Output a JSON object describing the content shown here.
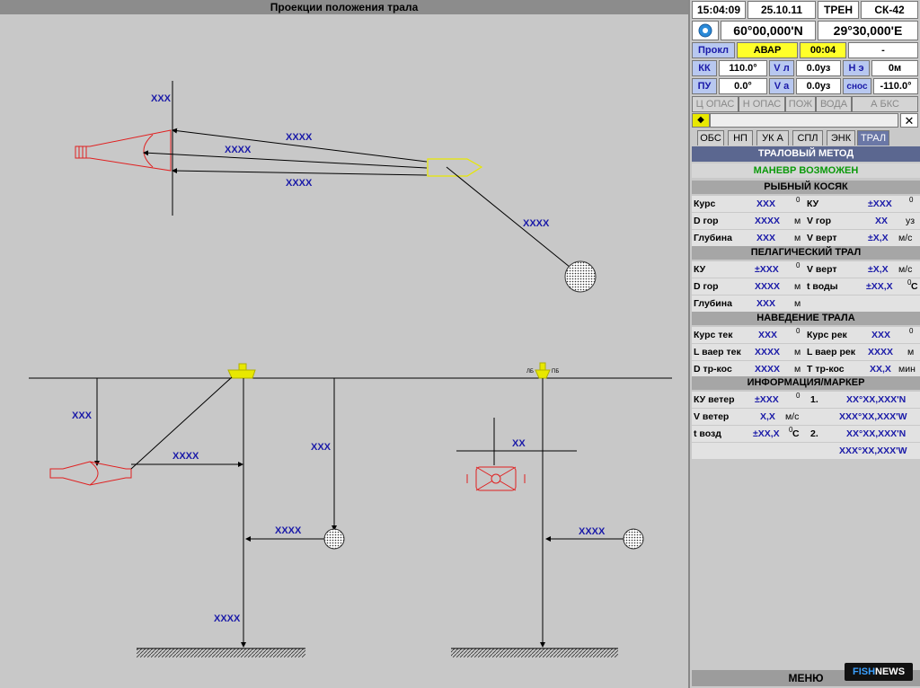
{
  "title": "Проекции положения трала",
  "header": {
    "time": "15:04:09",
    "date": "25.10.11",
    "mode": "ТРЕН",
    "system": "СК-42",
    "lat": "60°00,000'N",
    "lon": "29°30,000'E",
    "prokl_label": "Прокл",
    "avar_label": "АВАР",
    "avar_time": "00:04",
    "dash": "-",
    "kk_label": "КК",
    "kk_value": "110.0°",
    "vl_label": "V л",
    "vl_value": "0.0уз",
    "he_label": "Н э",
    "he_value": "0м",
    "pu_label": "ПУ",
    "pu_value": "0.0°",
    "va_label": "V а",
    "va_value": "0.0уз",
    "snos_label": "снос",
    "snos_value": "-110.0°"
  },
  "alarms": [
    "Ц ОПАС",
    "Н ОПАС",
    "ПОЖ",
    "ВОДА",
    "А БКС"
  ],
  "tabs": [
    "ОБС",
    "НП",
    "УК А",
    "СПЛ",
    "ЭНК",
    "ТРАЛ"
  ],
  "panel": {
    "method": "ТРАЛОВЫЙ МЕТОД",
    "maneuver": "МАНЕВР ВОЗМОЖЕН",
    "fish_school": "РЫБНЫЙ КОСЯК",
    "pelagic": "ПЕЛАГИЧЕСКИЙ ТРАЛ",
    "guidance": "НАВЕДЕНИЕ ТРАЛА",
    "info": "ИНФОРМАЦИЯ/МАРКЕР",
    "menu": "МЕНЮ"
  },
  "fish": {
    "kurs_l": "Курс",
    "kurs_v": "XXX",
    "deg": "0",
    "ku_l": "КУ",
    "ku_v": "±XXX",
    "dgor_l": "D гор",
    "dgor_v": "XXXX",
    "m": "м",
    "vgor_l": "V гор",
    "vgor_v": "XX",
    "uz": "уз",
    "gl_l": "Глубина",
    "gl_v": "XXX",
    "vvert_l": "V верт",
    "vvert_v": "±X,X",
    "ms": "м/с"
  },
  "pel": {
    "ku_l": "КУ",
    "ku_v": "±XXX",
    "vvert_l": "V верт",
    "vvert_v": "±X,X",
    "dgor_l": "D гор",
    "dgor_v": "XXXX",
    "tvod_l": "t воды",
    "tvod_v": "±XX,X",
    "c": "C",
    "gl_l": "Глубина",
    "gl_v": "XXX"
  },
  "guide": {
    "kt_l": "Курс тек",
    "kt_v": "XXX",
    "kr_l": "Курс рек",
    "kr_v": "XXX",
    "lvt_l": "L ваер тек",
    "lvt_v": "XXXX",
    "lvr_l": "L ваер рек",
    "lvr_v": "XXXX",
    "dtr_l": "D тр-кос",
    "dtr_v": "XXXX",
    "ttr_l": "Т тр-кос",
    "ttr_v": "XX,X",
    "min": "мин"
  },
  "info": {
    "kuw_l": "КУ ветер",
    "kuw_v": "±XXX",
    "n1": "1.",
    "p1a": "XX°XX,XXX'N",
    "vw_l": "V ветер",
    "vw_v": "X,X",
    "p1b": "XXX°XX,XXX'W",
    "tv_l": "t возд",
    "tv_v": "±XX,X",
    "n2": "2.",
    "p2a": "XX°XX,XXX'N",
    "p2b": "XXX°XX,XXX'W"
  },
  "scene": {
    "top_xxx": "XXX",
    "top_xxxx_1": "XXXX",
    "top_xxxx_2": "XXXX",
    "top_xxxx_3": "XXXX",
    "top_xxxx_4": "XXXX",
    "side_xxx_1": "XXX",
    "side_xxxx_1": "XXXX",
    "side_xxx_2": "XXX",
    "side_xxxx_2": "XXXX",
    "side_xxxx_3": "XXXX",
    "front_xx": "XX",
    "front_xxxx": "XXXX",
    "lb": "ЛБ",
    "pb": "ПБ"
  },
  "logo": {
    "a": "FISH",
    "b": "NEWS"
  },
  "colors": {
    "value_blue": "#1a1aa8",
    "trawl_red": "#e02020",
    "vessel_yellow": "#e8e800",
    "active_tab": "#6a77a6"
  }
}
